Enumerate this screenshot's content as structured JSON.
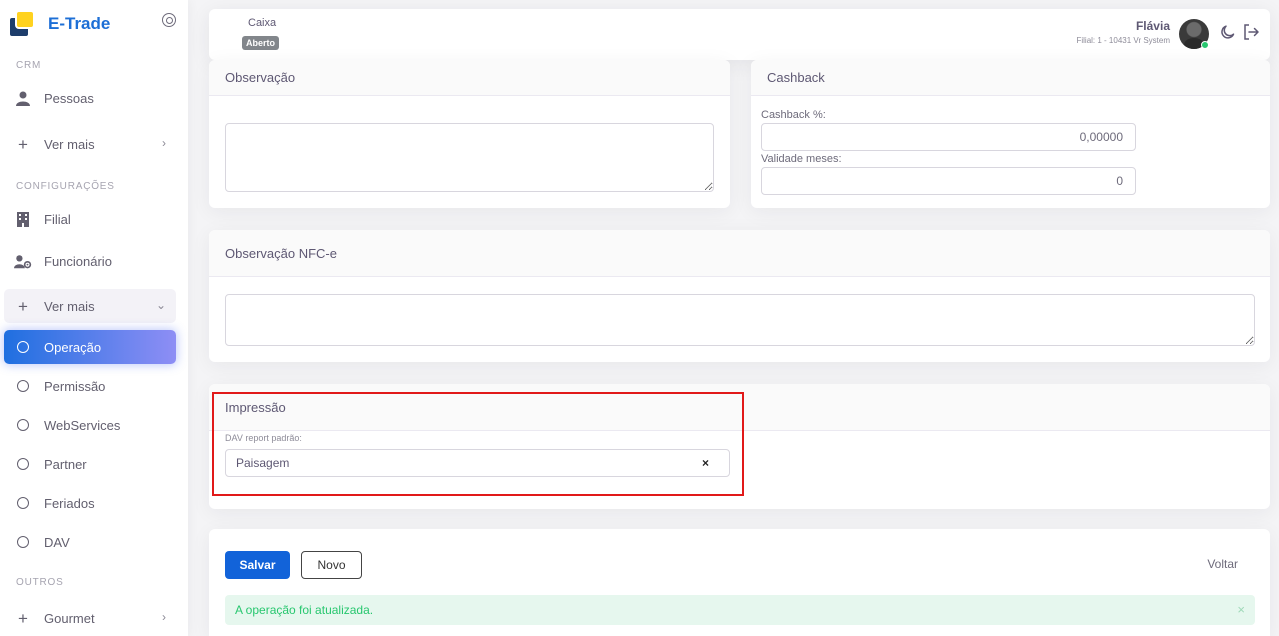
{
  "app": {
    "name": "E-Trade"
  },
  "sidebar": {
    "sections": {
      "crm": "CRM",
      "config": "CONFIGURAÇÕES",
      "outros": "OUTROS"
    },
    "items": {
      "pessoas": "Pessoas",
      "ver_mais_1": "Ver mais",
      "filial": "Filial",
      "funcionario": "Funcionário",
      "ver_mais_2": "Ver mais",
      "operacao": "Operação",
      "permissao": "Permissão",
      "webservices": "WebServices",
      "partner": "Partner",
      "feriados": "Feriados",
      "dav": "DAV",
      "gourmet": "Gourmet"
    }
  },
  "header": {
    "caixa_label": "Caixa",
    "caixa_status": "Aberto",
    "user_name": "Flávia",
    "user_branch": "Filial: 1 - 10431 Vr System"
  },
  "observacao": {
    "title": "Observação",
    "value": ""
  },
  "cashback": {
    "title": "Cashback",
    "percent_label": "Cashback %:",
    "percent_value": "0,00000",
    "validade_label": "Validade meses:",
    "validade_value": "0"
  },
  "observacao_nfce": {
    "title": "Observação NFC-e",
    "value": ""
  },
  "impressao": {
    "title": "Impressão",
    "dav_label": "DAV report padrão:",
    "dav_value": "Paisagem",
    "clear": "×"
  },
  "actions": {
    "save": "Salvar",
    "new": "Novo",
    "back": "Voltar"
  },
  "alert": {
    "message": "A operação foi atualizada.",
    "close": "×"
  }
}
